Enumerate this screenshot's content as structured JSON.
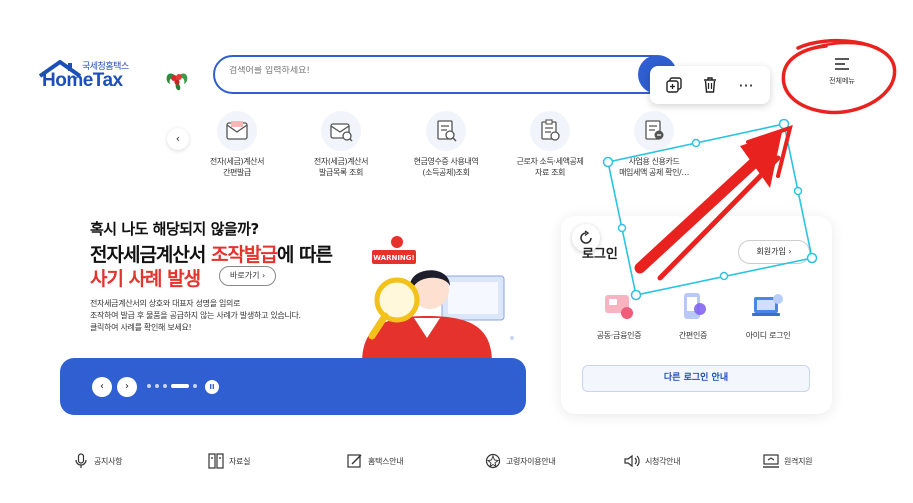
{
  "logo": {
    "sub": "국세청홈택스",
    "main": "HomeTax"
  },
  "search": {
    "placeholder": "검색어를 입력하세요!"
  },
  "float_bar": {
    "icons": [
      "copy-icon",
      "trash-icon",
      "more-icon"
    ],
    "more_label": "···"
  },
  "total_menu": {
    "label": "전체메뉴"
  },
  "quick_services": [
    {
      "label": "전자(세금)계산서\n간편발급",
      "icon": "invoice-issue-icon"
    },
    {
      "label": "전자(세금)계산서\n발급목록 조회",
      "icon": "invoice-list-icon"
    },
    {
      "label": "현금영수증 사용내역\n(소득공제)조회",
      "icon": "cash-receipt-icon"
    },
    {
      "label": "근로자 소득·세액공제\n자료 조회",
      "icon": "worker-deduction-icon"
    },
    {
      "label": "사업용 신용카드\n매입세액 공제 확인/…",
      "icon": "business-card-icon"
    }
  ],
  "banner": {
    "question": "혹시 나도  해당되지 않을까?",
    "title1_a": "전자세금계산서 ",
    "title1_b": "조작발급",
    "title1_c": "에 따른",
    "title2": "사기 사례 발생",
    "go_label": "바로가기",
    "desc": "전자세금계산서의 상호와 대표자 성명을 임의로\n조작하여 발급 후 물품을 공급하지 않는 사례가 발생하고 있습니다.\n클릭하여 사례를 확인해 보세요!",
    "warning_sign": "WARNING!"
  },
  "carousel": {
    "prev": "‹",
    "next": "›",
    "pause": "II",
    "dot_count": 5,
    "active_dot": 3
  },
  "login": {
    "title": "로그인",
    "join": "회원가입",
    "options": [
      {
        "label": "공동·금융인증",
        "icon": "certificate-icon"
      },
      {
        "label": "간편인증",
        "icon": "simple-auth-icon"
      },
      {
        "label": "아이디 로그인",
        "icon": "id-login-icon"
      }
    ],
    "other": "다른 로그인 안내"
  },
  "footer": [
    {
      "label": "공지사항",
      "icon": "microphone-icon"
    },
    {
      "label": "자료실",
      "icon": "archive-icon"
    },
    {
      "label": "홈택스안내",
      "icon": "guide-icon"
    },
    {
      "label": "고령자이용안내",
      "icon": "elderly-icon"
    },
    {
      "label": "시청각안내",
      "icon": "speaker-icon"
    },
    {
      "label": "원격지원",
      "icon": "remote-icon"
    }
  ],
  "colors": {
    "brand": "#2f5fd0",
    "accent_red": "#e5322d",
    "annotation_cyan": "#29c4e0",
    "annotation_red": "#e8231f"
  }
}
